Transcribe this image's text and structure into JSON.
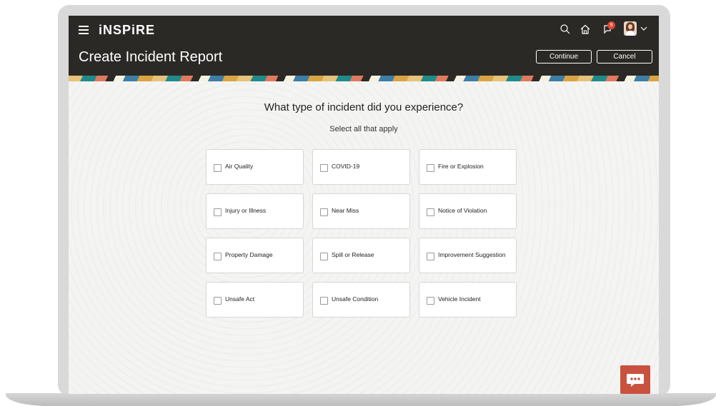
{
  "app": {
    "logo": "iNSPiRE"
  },
  "header": {
    "notification_count": "9",
    "page_title": "Create Incident Report",
    "continue_label": "Continue",
    "cancel_label": "Cancel"
  },
  "form": {
    "question": "What type of incident did you experience?",
    "instruction": "Select all that apply",
    "options": [
      {
        "label": "Air Quality",
        "checked": false
      },
      {
        "label": "COVID-19",
        "checked": false
      },
      {
        "label": "Fire or Explosion",
        "checked": false
      },
      {
        "label": "Injury or Illness",
        "checked": false
      },
      {
        "label": "Near Miss",
        "checked": false
      },
      {
        "label": "Notice of Violation",
        "checked": false
      },
      {
        "label": "Property Damage",
        "checked": false
      },
      {
        "label": "Spill or Release",
        "checked": false
      },
      {
        "label": "Improvement Suggestion",
        "checked": false
      },
      {
        "label": "Unsafe Act",
        "checked": false
      },
      {
        "label": "Unsafe Condition",
        "checked": false
      },
      {
        "label": "Vehicle Incident",
        "checked": false
      }
    ]
  },
  "colors": {
    "header_bg": "#2b2926",
    "chat_button": "#c9523f",
    "notification_badge": "#e0472f"
  },
  "icons": [
    "menu-icon",
    "search-icon",
    "home-icon",
    "notifications-icon",
    "avatar",
    "chevron-down-icon",
    "chat-icon"
  ]
}
